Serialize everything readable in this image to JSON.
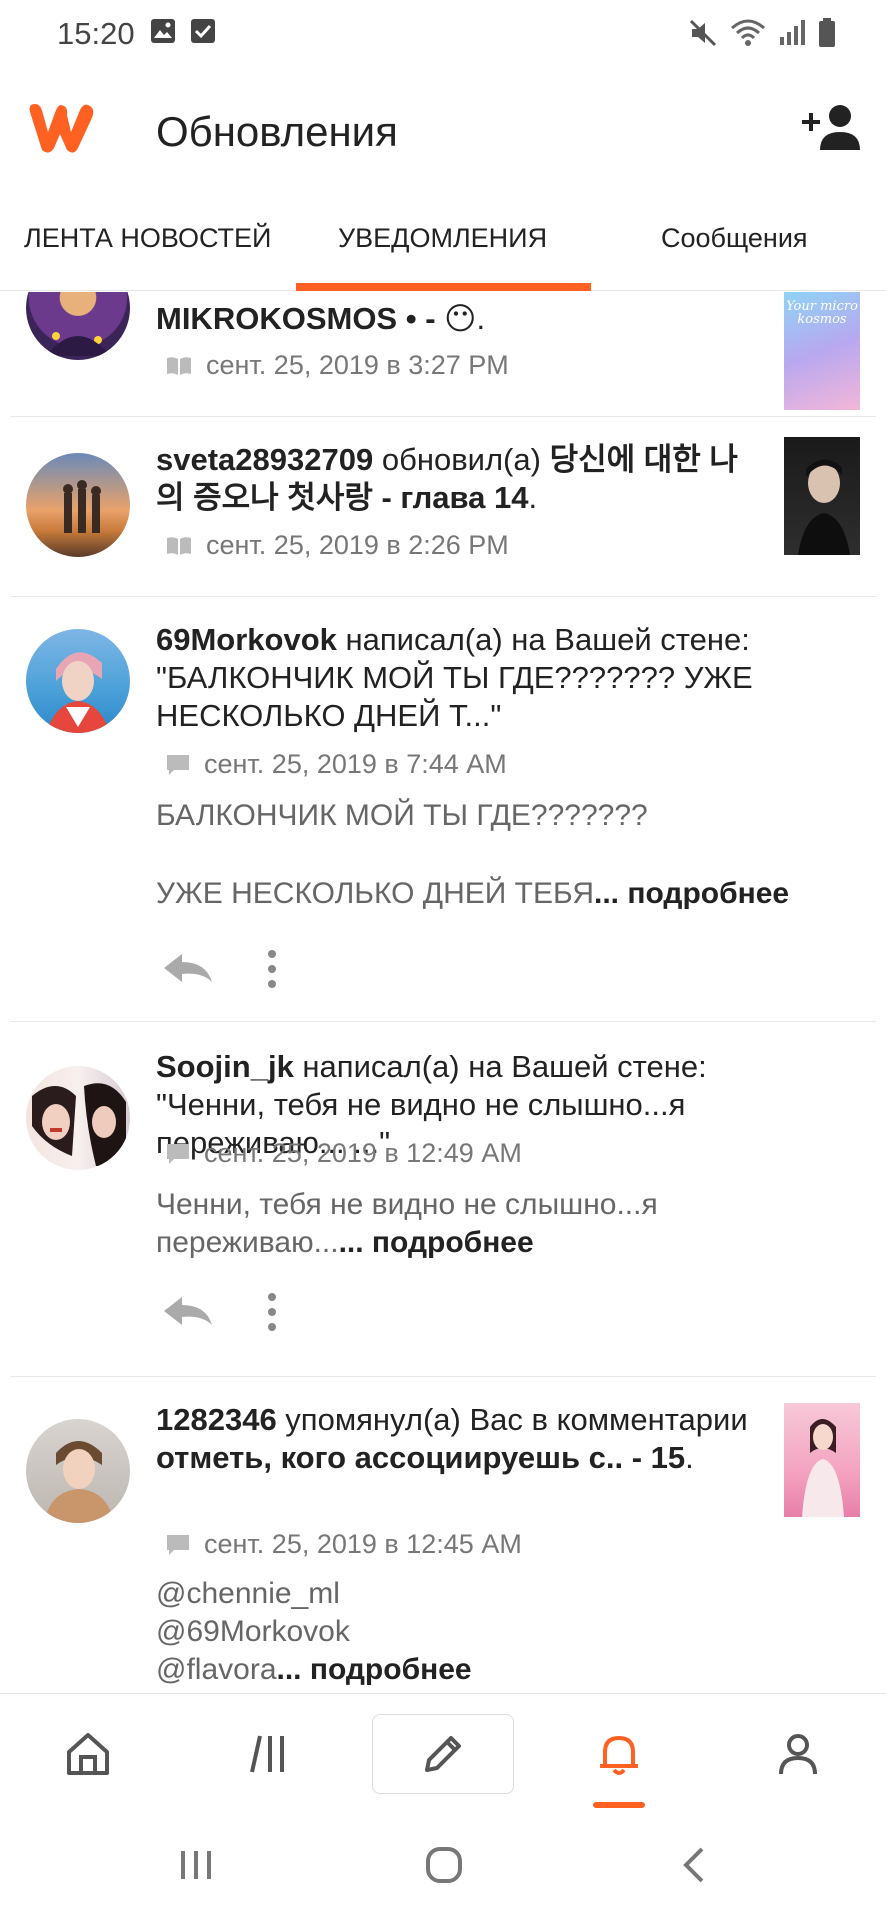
{
  "status_bar": {
    "time": "15:20"
  },
  "app_bar": {
    "title": "Обновления"
  },
  "tabs": [
    {
      "label": "ЛЕНТА НОВОСТЕЙ",
      "active": false
    },
    {
      "label": "УВЕДОМЛЕНИЯ",
      "active": true
    },
    {
      "label": "Сообщения",
      "active": false
    }
  ],
  "accent_color": "#ff6122",
  "feed": [
    {
      "type": "story-update",
      "text_tail_bold": "MIKROKOSMOS • - ",
      "emoji": "😶",
      "text_end": ".",
      "meta_icon": "book-icon",
      "timestamp": "сент. 25, 2019 в 3:27 PM",
      "thumb_text": "Your micro kosmos"
    },
    {
      "type": "story-update",
      "user": "sveta28932709",
      "action": " обновил(а) ",
      "story": "당신에 대한 나의 증오나 첫사랑",
      "chapter": " - глава 14",
      "text_end": ".",
      "meta_icon": "book-icon",
      "timestamp": "сент. 25, 2019 в 2:26 PM"
    },
    {
      "type": "wall-post",
      "user": "69Morkovok",
      "action": " написал(а) на Вашей стене: \"БАЛКОНЧИК МОЙ ТЫ ГДЕ??????? УЖЕ НЕСКОЛЬКО ДНЕЙ Т...\"",
      "meta_icon": "message-icon",
      "timestamp": "сент. 25, 2019 в 7:44 AM",
      "preview_line1": "БАЛКОНЧИК МОЙ ТЫ ГДЕ???????",
      "preview_line2": "УЖЕ НЕСКОЛЬКО ДНЕЙ ТЕБЯ",
      "more_label": "... подробнее"
    },
    {
      "type": "wall-post",
      "user": "Soojin_jk",
      "action": " написал(а) на Вашей стене: \"Ченни, тебя не видно не слышно...я переживаю... ...\"",
      "meta_icon": "message-icon",
      "timestamp": "сент. 25, 2019 в 12:49 AM",
      "preview_line1": "Ченни, тебя не видно не слышно...я переживаю...",
      "more_label": "... подробнее"
    },
    {
      "type": "mention",
      "user": "1282346",
      "action": " упомянул(а) Вас в комментарии ",
      "story": "отметь, кого ассоциируешь с..",
      "chapter": " - 15",
      "text_end": ".",
      "meta_icon": "message-icon",
      "timestamp": "сент. 25, 2019 в 12:45 AM",
      "preview_line1": "@chennie_ml",
      "preview_line2": "@69Morkovok",
      "preview_line3": "@flavora",
      "more_label": "... подробнее"
    }
  ],
  "bottom_nav": [
    {
      "icon": "home-icon",
      "active": false
    },
    {
      "icon": "library-icon",
      "active": false
    },
    {
      "icon": "pencil-icon",
      "active": false
    },
    {
      "icon": "bell-icon",
      "active": true
    },
    {
      "icon": "profile-icon",
      "active": false
    }
  ]
}
